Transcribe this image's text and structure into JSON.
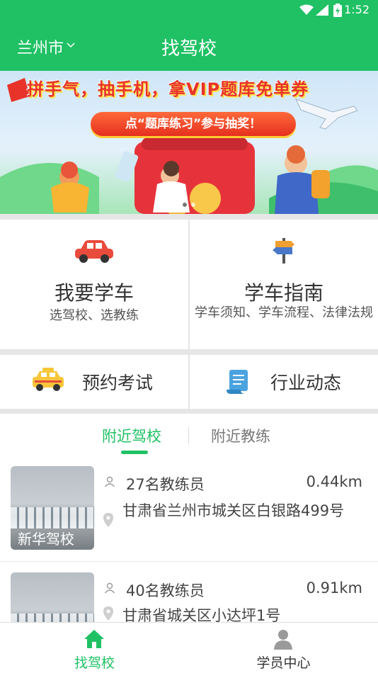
{
  "status_bar": {
    "time": "1:52",
    "icons": [
      "wifi-icon",
      "signal-icon",
      "battery-icon"
    ]
  },
  "nav_bar": {
    "city": "兰州市",
    "title": "找驾校",
    "background_color": "#1fc164"
  },
  "banner": {
    "headline": "拼手气，抽手机，拿VIP题库免单券",
    "cta": "点“题库练习”参与抽奖！",
    "page_count": 2,
    "active_page": 1
  },
  "features": {
    "learn": {
      "title": "我要学车",
      "subtitle": "选驾校、选教练",
      "icon": "car-icon"
    },
    "guide": {
      "title": "学车指南",
      "subtitle": "学车须知、学车流程、法律法规",
      "icon": "signpost-icon"
    },
    "exam": {
      "label": "预约考试",
      "icon": "taxi-icon"
    },
    "news": {
      "label": "行业动态",
      "icon": "scroll-icon"
    }
  },
  "tabs": [
    {
      "label": "附近驾校",
      "active": true
    },
    {
      "label": "附近教练",
      "active": false
    }
  ],
  "schools": [
    {
      "name": "新华驾校",
      "coach_count": "27名教练员",
      "distance": "0.44km",
      "address": "甘肃省兰州市城关区白银路499号"
    },
    {
      "name": "",
      "coach_count": "40名教练员",
      "distance": "0.91km",
      "address": "甘肃省城关区小达坪1号"
    }
  ],
  "bottom_nav": [
    {
      "label": "找驾校",
      "icon": "home-icon",
      "active": true
    },
    {
      "label": "学员中心",
      "icon": "user-icon",
      "active": false
    }
  ],
  "colors": {
    "accent": "#1fc164",
    "car_red": "#e94b3c",
    "taxi_yellow": "#f7c63a",
    "scroll_blue": "#4aa3df"
  }
}
